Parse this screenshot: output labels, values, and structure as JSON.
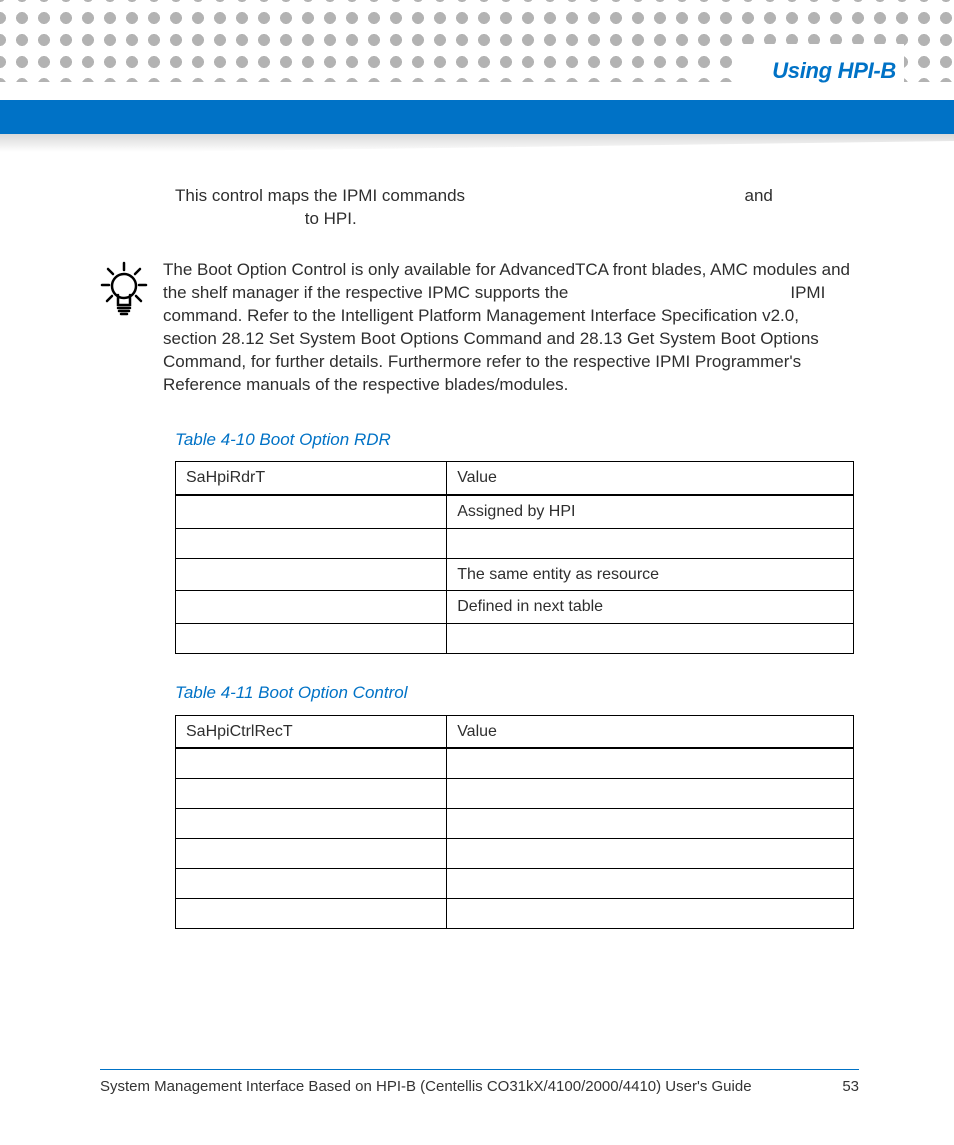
{
  "header": {
    "section_title": "Using HPI-B"
  },
  "body": {
    "intro_line1": "This control maps the IPMI commands",
    "intro_and": "and",
    "intro_line2": "to HPI.",
    "note_text": "The Boot Option Control is only available for AdvancedTCA front blades, AMC modules and the shelf manager if the respective IPMC supports the                                               IPMI command. Refer to the Intelligent Platform Management Interface Specification v2.0, section 28.12 Set System Boot Options Command and 28.13 Get System Boot Options Command, for further details. Furthermore refer to the respective IPMI Programmer's Reference manuals of the respective blades/modules."
  },
  "tables": {
    "t1": {
      "caption": "Table 4-10 Boot Option RDR",
      "header": {
        "c1": "SaHpiRdrT",
        "c2": "Value"
      },
      "rows": [
        {
          "c1": "",
          "c2": "Assigned by HPI"
        },
        {
          "c1": "",
          "c2": ""
        },
        {
          "c1": "",
          "c2": "The same entity as resource"
        },
        {
          "c1": "",
          "c2": "Defined in next table"
        },
        {
          "c1": "",
          "c2": ""
        }
      ]
    },
    "t2": {
      "caption": "Table 4-11 Boot Option Control",
      "header": {
        "c1": "SaHpiCtrlRecT",
        "c2": "Value"
      },
      "rows": [
        {
          "c1": "",
          "c2": ""
        },
        {
          "c1": "",
          "c2": ""
        },
        {
          "c1": "",
          "c2": ""
        },
        {
          "c1": "",
          "c2": ""
        },
        {
          "c1": "",
          "c2": ""
        },
        {
          "c1": "",
          "c2": ""
        }
      ]
    }
  },
  "footer": {
    "doc_title": "System Management Interface Based on HPI-B (Centellis CO31kX/4100/2000/4410) User's Guide",
    "page_number": "53"
  }
}
